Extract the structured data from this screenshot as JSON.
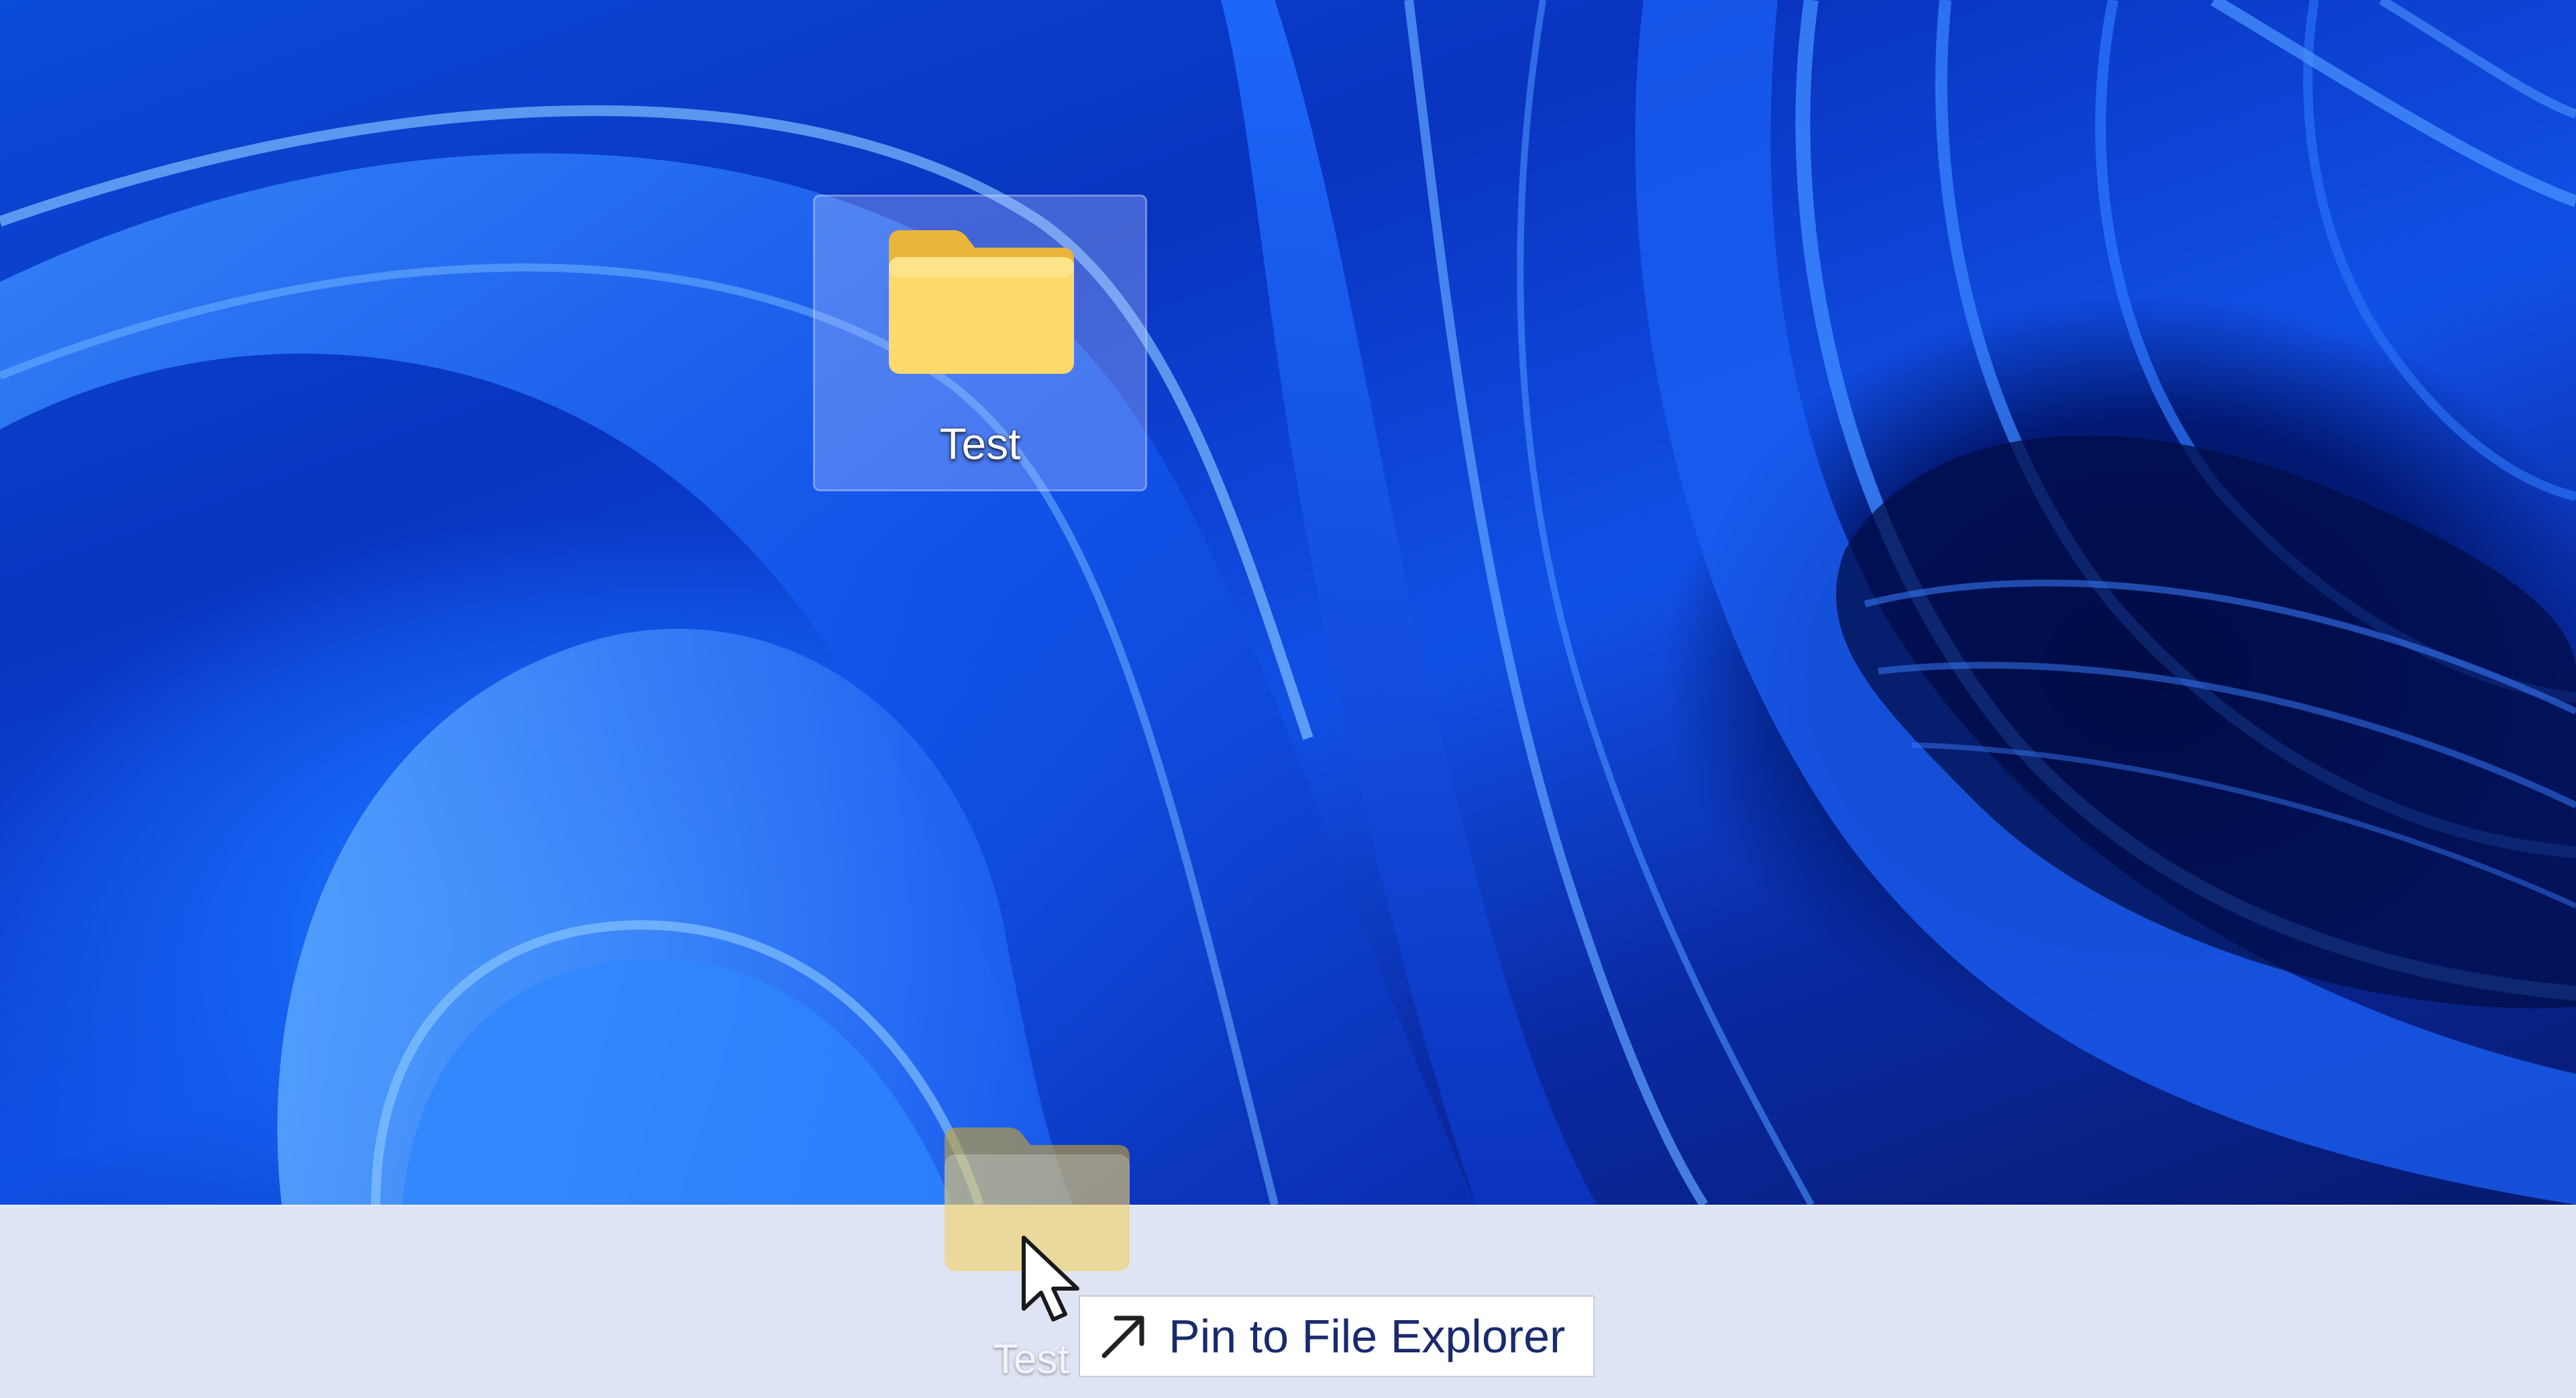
{
  "desktop": {
    "icon": {
      "label": "Test",
      "icon": "folder-icon",
      "selected": true
    }
  },
  "drag": {
    "ghost_label": "Test",
    "ghost_icon": "folder-icon",
    "tooltip": {
      "icon": "pin-arrow-icon",
      "text": "Pin to File Explorer"
    }
  },
  "colors": {
    "folder_front": "#fcd96a",
    "folder_back": "#e9b53c",
    "selection": "#bec8ff",
    "taskbar": "#dee4f3",
    "tooltip_text": "#1a2a6e"
  }
}
